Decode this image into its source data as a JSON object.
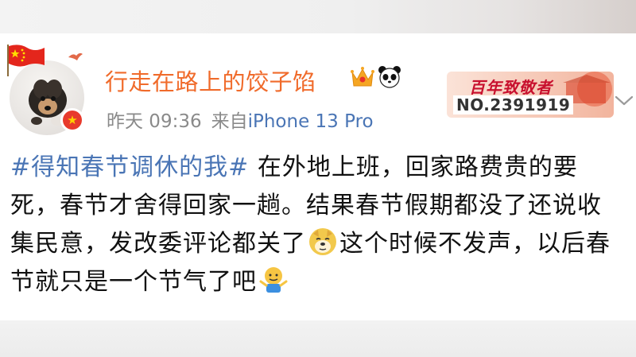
{
  "post": {
    "username": "行走在路上的饺子馅",
    "time": "昨天 09:36",
    "source_prefix": "来自",
    "device": "iPhone 13 Pro",
    "fan_badge_title": "百年致敬者",
    "fan_badge_number": "NO.2391919",
    "hashtag": "#得知春节调休的我#",
    "text_part1": " 在外地上班，回家路费贵的要死，春节才舍得回家一趟。结果春节假期都没了还说收集民意，发改委评论都关了",
    "text_part2": "这个时候不发声，以后春节就只是一个节气了吧",
    "emoji_1": "doge-emoji",
    "emoji_2": "shrug-emoji"
  },
  "colors": {
    "username": "#f06b2b",
    "link": "#4a75b5",
    "meta": "#8a8a8a",
    "badge_red": "#c8102e"
  }
}
